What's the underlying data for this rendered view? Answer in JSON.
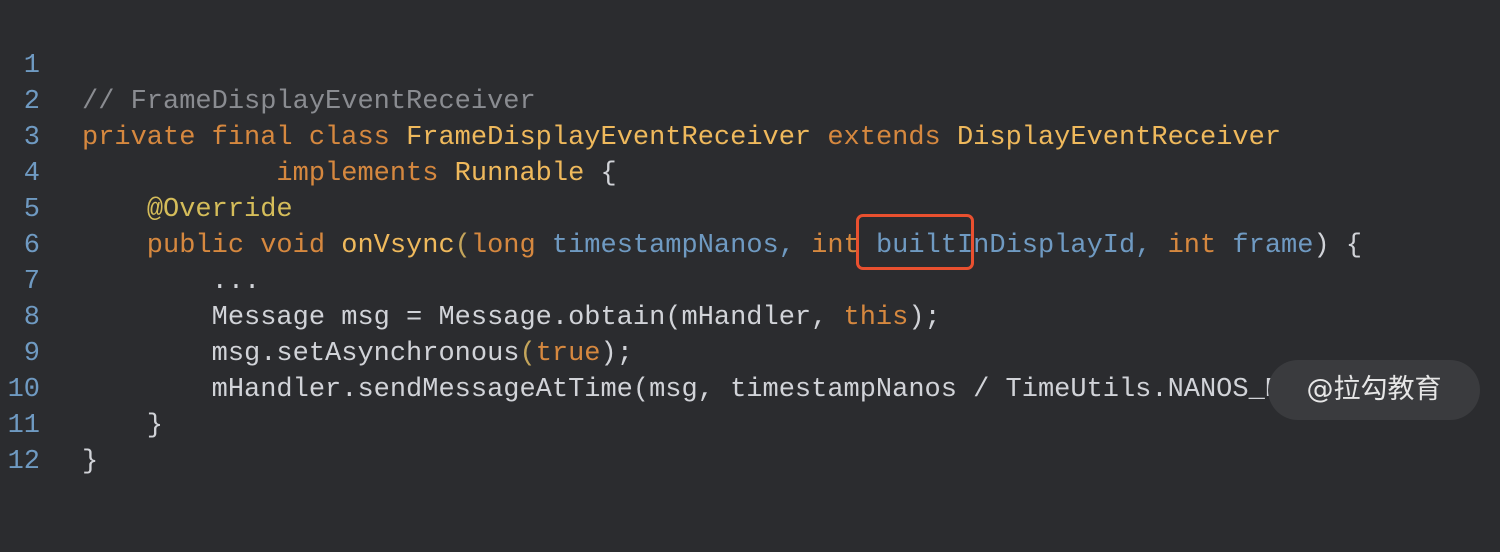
{
  "editor": {
    "line_numbers": [
      "1",
      "2",
      "3",
      "4",
      "5",
      "6",
      "7",
      "8",
      "9",
      "10",
      "11",
      "12"
    ],
    "lines": [
      {
        "t1": "// FrameDisplayEventReceiver"
      },
      {
        "t1": "private final class ",
        "t2": "FrameDisplayEventReceiver",
        "t3": " extends ",
        "t4": "DisplayEventReceiver"
      },
      {
        "t1": "            implements ",
        "t2": "Runnable",
        "t3": " {"
      },
      {
        "t1": "    ",
        "t2": "@Override"
      },
      {
        "t1": "    public void ",
        "t2": "onVsync",
        "t3": "(",
        "t4": "long ",
        "t5": "timestampNanos",
        "t6": ", ",
        "t7": "int ",
        "t8": "builtInDisplayId",
        "t9": ", ",
        "t10": "int ",
        "t11": "frame",
        "t12": ") {"
      },
      {
        "t1": "        ..."
      },
      {
        "t1": "        Message msg = Message.obtain(mHandler, ",
        "t2": "this",
        "t3": ");"
      },
      {
        "t1": "        msg.setAsynchronous",
        "t2": "(",
        "t3": "true",
        "t4": ");"
      },
      {
        "t1": "        mHandler.sendMessageAtTime(msg, timestampNanos / TimeUtils.NANOS_PER_MS);"
      },
      {
        "t1": "    }"
      },
      {
        "t1": "}"
      },
      {
        "t1": ""
      }
    ]
  },
  "watermark": {
    "text": "@拉勾教育"
  },
  "colors": {
    "background": "#2b2c2f",
    "keyword": "#d6883f",
    "class_name": "#efb95c",
    "annotation": "#d5bd5a",
    "parameter": "#6f9ac2",
    "comment": "#8a8c91",
    "plain": "#d1d3d8",
    "highlight_border": "#e9502f"
  }
}
